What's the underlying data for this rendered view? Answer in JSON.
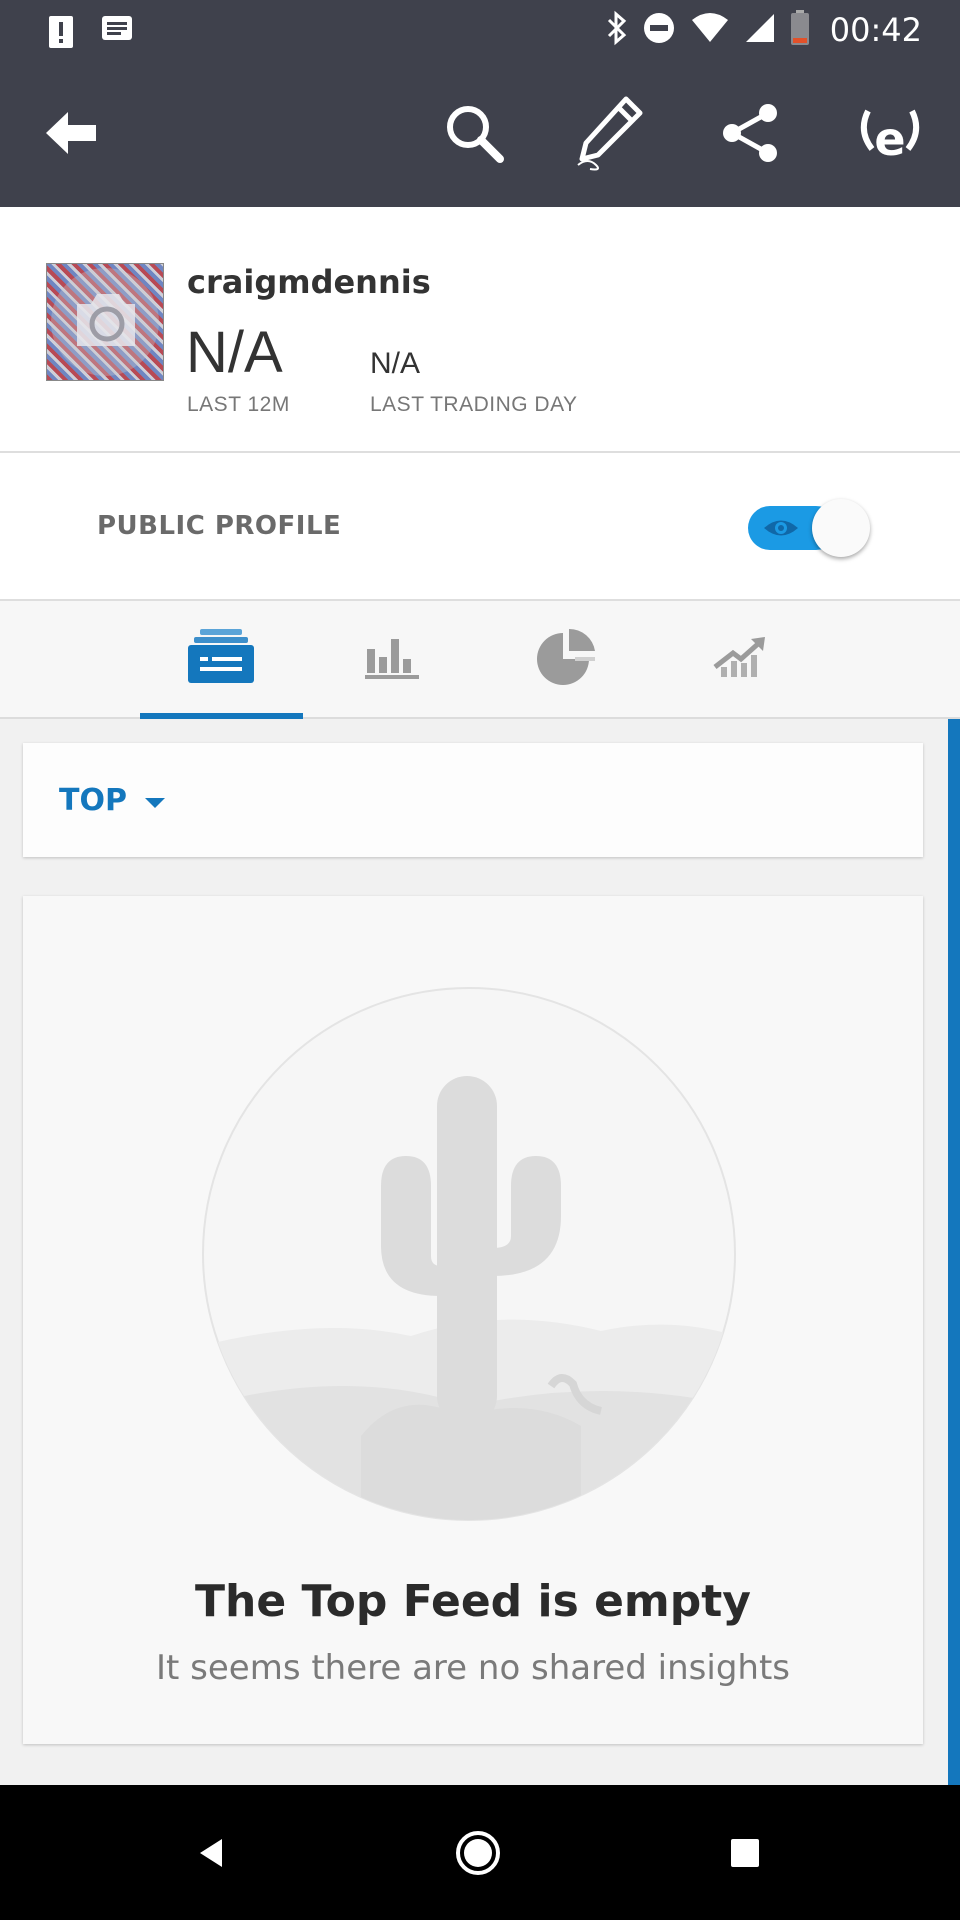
{
  "status_bar": {
    "time": "00:42",
    "left_icons": [
      "alert-icon",
      "message-icon"
    ],
    "right_icons": [
      "bluetooth-icon",
      "do-not-disturb-icon",
      "wifi-icon",
      "signal-icon",
      "battery-icon"
    ]
  },
  "app_bar": {
    "icons": [
      "back-arrow-icon",
      "search-icon",
      "edit-pencil-icon",
      "share-icon",
      "etoro-logo-icon"
    ]
  },
  "profile": {
    "username": "craigmdennis",
    "gain_12m": "N/A",
    "gain_12m_label": "LAST 12M",
    "gain_day": "N/A",
    "gain_day_label": "LAST TRADING DAY"
  },
  "public_profile": {
    "label": "PUBLIC PROFILE",
    "enabled": true
  },
  "tabs": [
    {
      "icon": "feed-icon",
      "active": true
    },
    {
      "icon": "bar-chart-icon",
      "active": false
    },
    {
      "icon": "pie-chart-icon",
      "active": false
    },
    {
      "icon": "trending-up-icon",
      "active": false
    }
  ],
  "feed": {
    "filter_label": "TOP",
    "empty_title": "The Top Feed is empty",
    "empty_subtitle": "It seems there are no shared insights"
  },
  "colors": {
    "accent": "#1477bd",
    "toggle": "#1b9ae4",
    "bar": "#3f414c"
  },
  "nav_bar": {
    "icons": [
      "nav-back-icon",
      "nav-home-icon",
      "nav-recents-icon"
    ]
  }
}
